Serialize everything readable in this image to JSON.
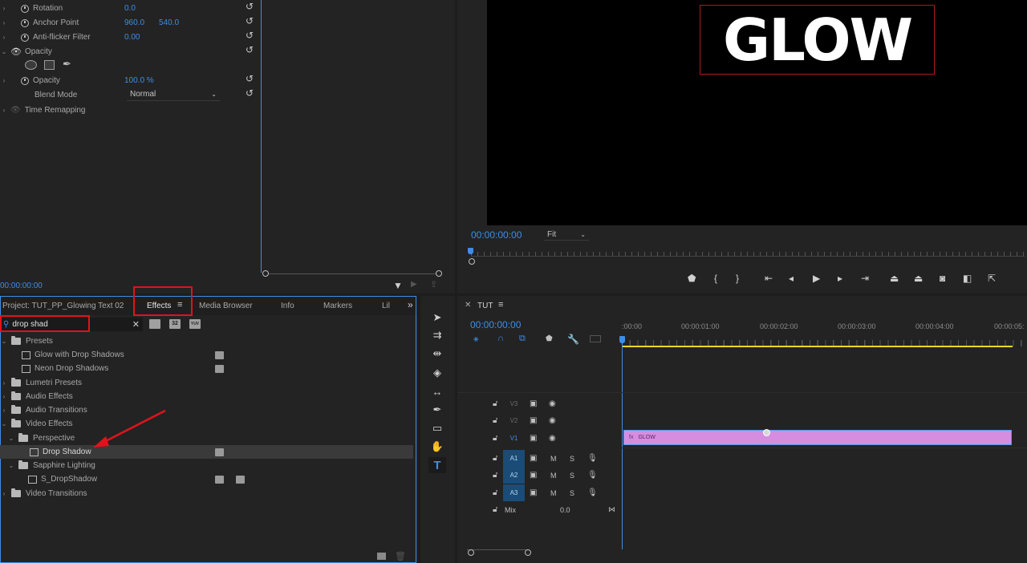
{
  "effect_controls": {
    "rows": [
      {
        "label": "Rotation",
        "v1": "0.0",
        "v2": ""
      },
      {
        "label": "Anchor Point",
        "v1": "960.0",
        "v2": "540.0"
      },
      {
        "label": "Anti-flicker Filter",
        "v1": "0.00",
        "v2": ""
      }
    ],
    "opacity_section": "Opacity",
    "opacity_label": "Opacity",
    "opacity_value": "100.0 %",
    "blend_label": "Blend Mode",
    "blend_value": "Normal",
    "time_remap": "Time Remapping",
    "timecode": "00:00:00:00"
  },
  "program": {
    "title_text": "GLOW",
    "timecode": "00:00:00:00",
    "zoom": "Fit"
  },
  "effects_panel": {
    "tabs": [
      "Project: TUT_PP_Glowing Text 02",
      "Effects",
      "Media Browser",
      "Info",
      "Markers",
      "Lil"
    ],
    "overflow": "»",
    "search_value": "drop shad",
    "badges": [
      "32",
      "YUV"
    ],
    "tree": [
      {
        "label": "Presets",
        "level": 0,
        "type": "preset-folder",
        "open": true
      },
      {
        "label": "Glow with Drop Shadows",
        "level": 1,
        "type": "preset"
      },
      {
        "label": "Neon Drop Shadows",
        "level": 1,
        "type": "preset"
      },
      {
        "label": "Lumetri Presets",
        "level": 0,
        "type": "preset-folder",
        "open": false
      },
      {
        "label": "Audio Effects",
        "level": 0,
        "type": "folder",
        "open": false
      },
      {
        "label": "Audio Transitions",
        "level": 0,
        "type": "folder",
        "open": false
      },
      {
        "label": "Video Effects",
        "level": 0,
        "type": "folder",
        "open": true
      },
      {
        "label": "Perspective",
        "level": 1,
        "type": "folder",
        "open": true
      },
      {
        "label": "Drop Shadow",
        "level": 2,
        "type": "effect",
        "selected": true
      },
      {
        "label": "Sapphire Lighting",
        "level": 1,
        "type": "folder",
        "open": true
      },
      {
        "label": "S_DropShadow",
        "level": 2,
        "type": "effect"
      },
      {
        "label": "Video Transitions",
        "level": 0,
        "type": "folder",
        "open": false
      }
    ]
  },
  "timeline": {
    "sequence": "TUT",
    "timecode": "00:00:00:00",
    "ruler": [
      ":00:00",
      "00:00:01:00",
      "00:00:02:00",
      "00:00:03:00",
      "00:00:04:00",
      "00:00:05:"
    ],
    "video_tracks": [
      "V3",
      "V2",
      "V1"
    ],
    "audio_tracks": [
      "A1",
      "A2",
      "A3"
    ],
    "mute": "M",
    "solo": "S",
    "mix_label": "Mix",
    "mix_value": "0.0",
    "clip_name": "GLOW",
    "clip_color": "#d58de0"
  },
  "colors": {
    "accent": "#3e8de6",
    "highlight": "#e0131b",
    "work_area": "#e8d923"
  }
}
